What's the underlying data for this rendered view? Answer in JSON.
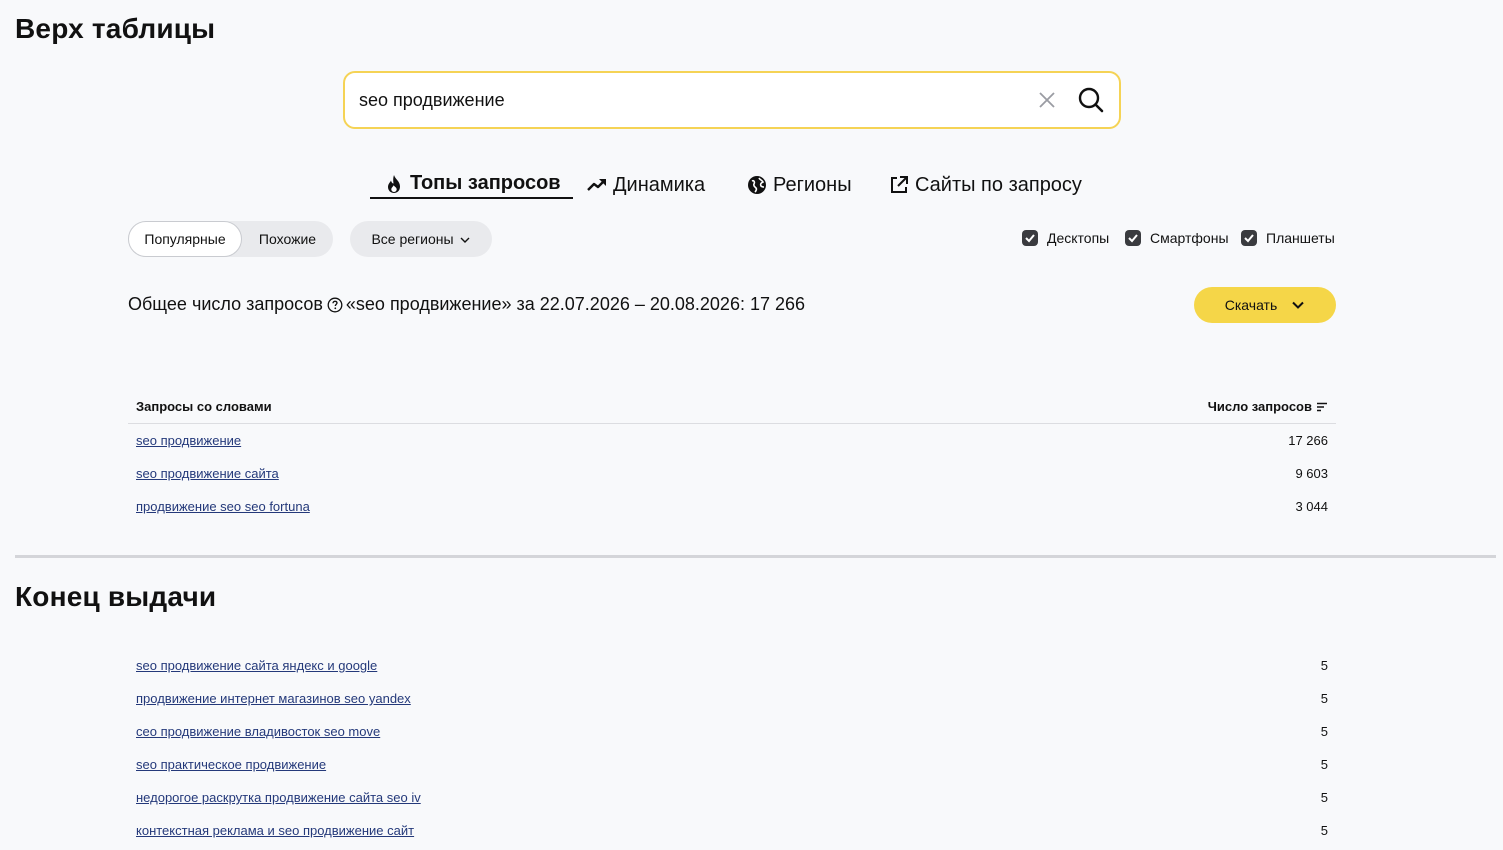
{
  "sections": {
    "top_heading": "Верх таблицы",
    "end_heading": "Конец выдачи"
  },
  "search": {
    "value": "seo продвижение",
    "clear_icon": "close-icon",
    "search_icon": "search-icon"
  },
  "tabs": [
    {
      "label": "Топы запросов",
      "icon": "fire-icon",
      "active": true
    },
    {
      "label": "Динамика",
      "icon": "trend-up-icon",
      "active": false
    },
    {
      "label": "Регионы",
      "icon": "globe-icon",
      "active": false
    },
    {
      "label": "Сайты по запросу",
      "icon": "external-link-icon",
      "active": false
    }
  ],
  "filters": {
    "popular": "Популярные",
    "similar": "Похожие",
    "regions": "Все регионы"
  },
  "devices": [
    {
      "label": "Десктопы",
      "checked": true
    },
    {
      "label": "Смартфоны",
      "checked": true
    },
    {
      "label": "Планшеты",
      "checked": true
    }
  ],
  "summary": {
    "prefix": "Общее число запросов",
    "rest": "«seo продвижение» за 22.07.2026 – 20.08.2026: 17 266"
  },
  "download_label": "Скачать",
  "table": {
    "col_query": "Запросы со словами",
    "col_count": "Число запросов",
    "top_rows": [
      {
        "query": "seo продвижение",
        "count": "17 266"
      },
      {
        "query": "seo продвижение сайта",
        "count": "9 603"
      },
      {
        "query": "продвижение seo seo fortuna",
        "count": "3 044"
      }
    ],
    "end_rows": [
      {
        "query": "seo продвижение сайта яндекс и google",
        "count": "5"
      },
      {
        "query": "продвижение интернет магазинов seo yandex",
        "count": "5"
      },
      {
        "query": "сео продвижение владивосток seo move",
        "count": "5"
      },
      {
        "query": "seo практическое продвижение",
        "count": "5"
      },
      {
        "query": "недорогое раскрутка продвижение сайта seo iv",
        "count": "5"
      },
      {
        "query": "контекстная реклама и seo продвижение сайт",
        "count": "5"
      }
    ]
  },
  "colors": {
    "accent_yellow": "#f5d648",
    "search_border": "#f5d355",
    "link": "#24397a"
  }
}
